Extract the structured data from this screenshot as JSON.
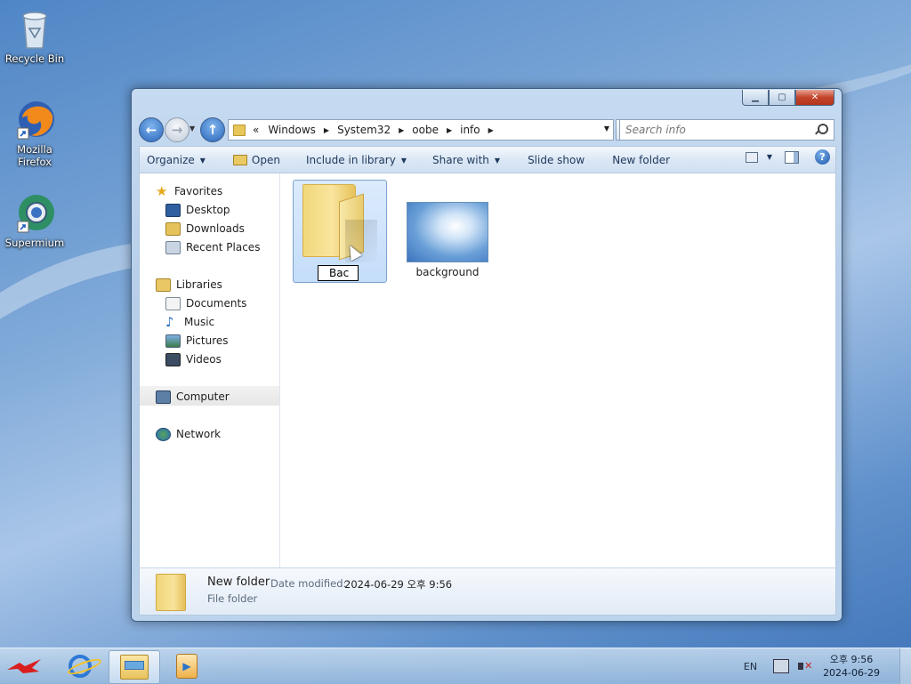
{
  "desktop": {
    "icons": [
      {
        "label": "Recycle Bin",
        "icon": "recycle-bin-icon"
      },
      {
        "label": "Mozilla Firefox",
        "icon": "firefox-icon"
      },
      {
        "label": "Supermium",
        "icon": "supermium-icon"
      }
    ]
  },
  "window": {
    "controls": {
      "minimize": "▁",
      "maximize": "▢",
      "close": "✕"
    },
    "address": {
      "overflow": "«",
      "crumbs": [
        "Windows",
        "System32",
        "oobe",
        "info"
      ]
    },
    "search": {
      "placeholder": "Search info"
    },
    "toolbar": {
      "organize": "Organize",
      "open": "Open",
      "include_in_library": "Include in library",
      "share_with": "Share with",
      "slide_show": "Slide show",
      "new_folder": "New folder",
      "help": "?"
    },
    "navpane": {
      "favorites": "Favorites",
      "desktop": "Desktop",
      "downloads": "Downloads",
      "recent_places": "Recent Places",
      "libraries": "Libraries",
      "documents": "Documents",
      "music": "Music",
      "pictures": "Pictures",
      "videos": "Videos",
      "computer": "Computer",
      "network": "Network"
    },
    "content": {
      "items": [
        {
          "type": "folder",
          "rename_value": "Bac",
          "selected": true
        },
        {
          "type": "image",
          "label": "background"
        }
      ]
    },
    "details": {
      "name": "New folder",
      "date_label": "Date modified:",
      "date_value": "2024-06-29 오후 9:56",
      "type": "File folder"
    }
  },
  "taskbar": {
    "language": "EN",
    "clock_time": "오후 9:56",
    "clock_date": "2024-06-29"
  },
  "colors": {
    "window_frame": "#c6dbf1",
    "selection": "#c4ddfa",
    "close_button": "#c4442c"
  }
}
